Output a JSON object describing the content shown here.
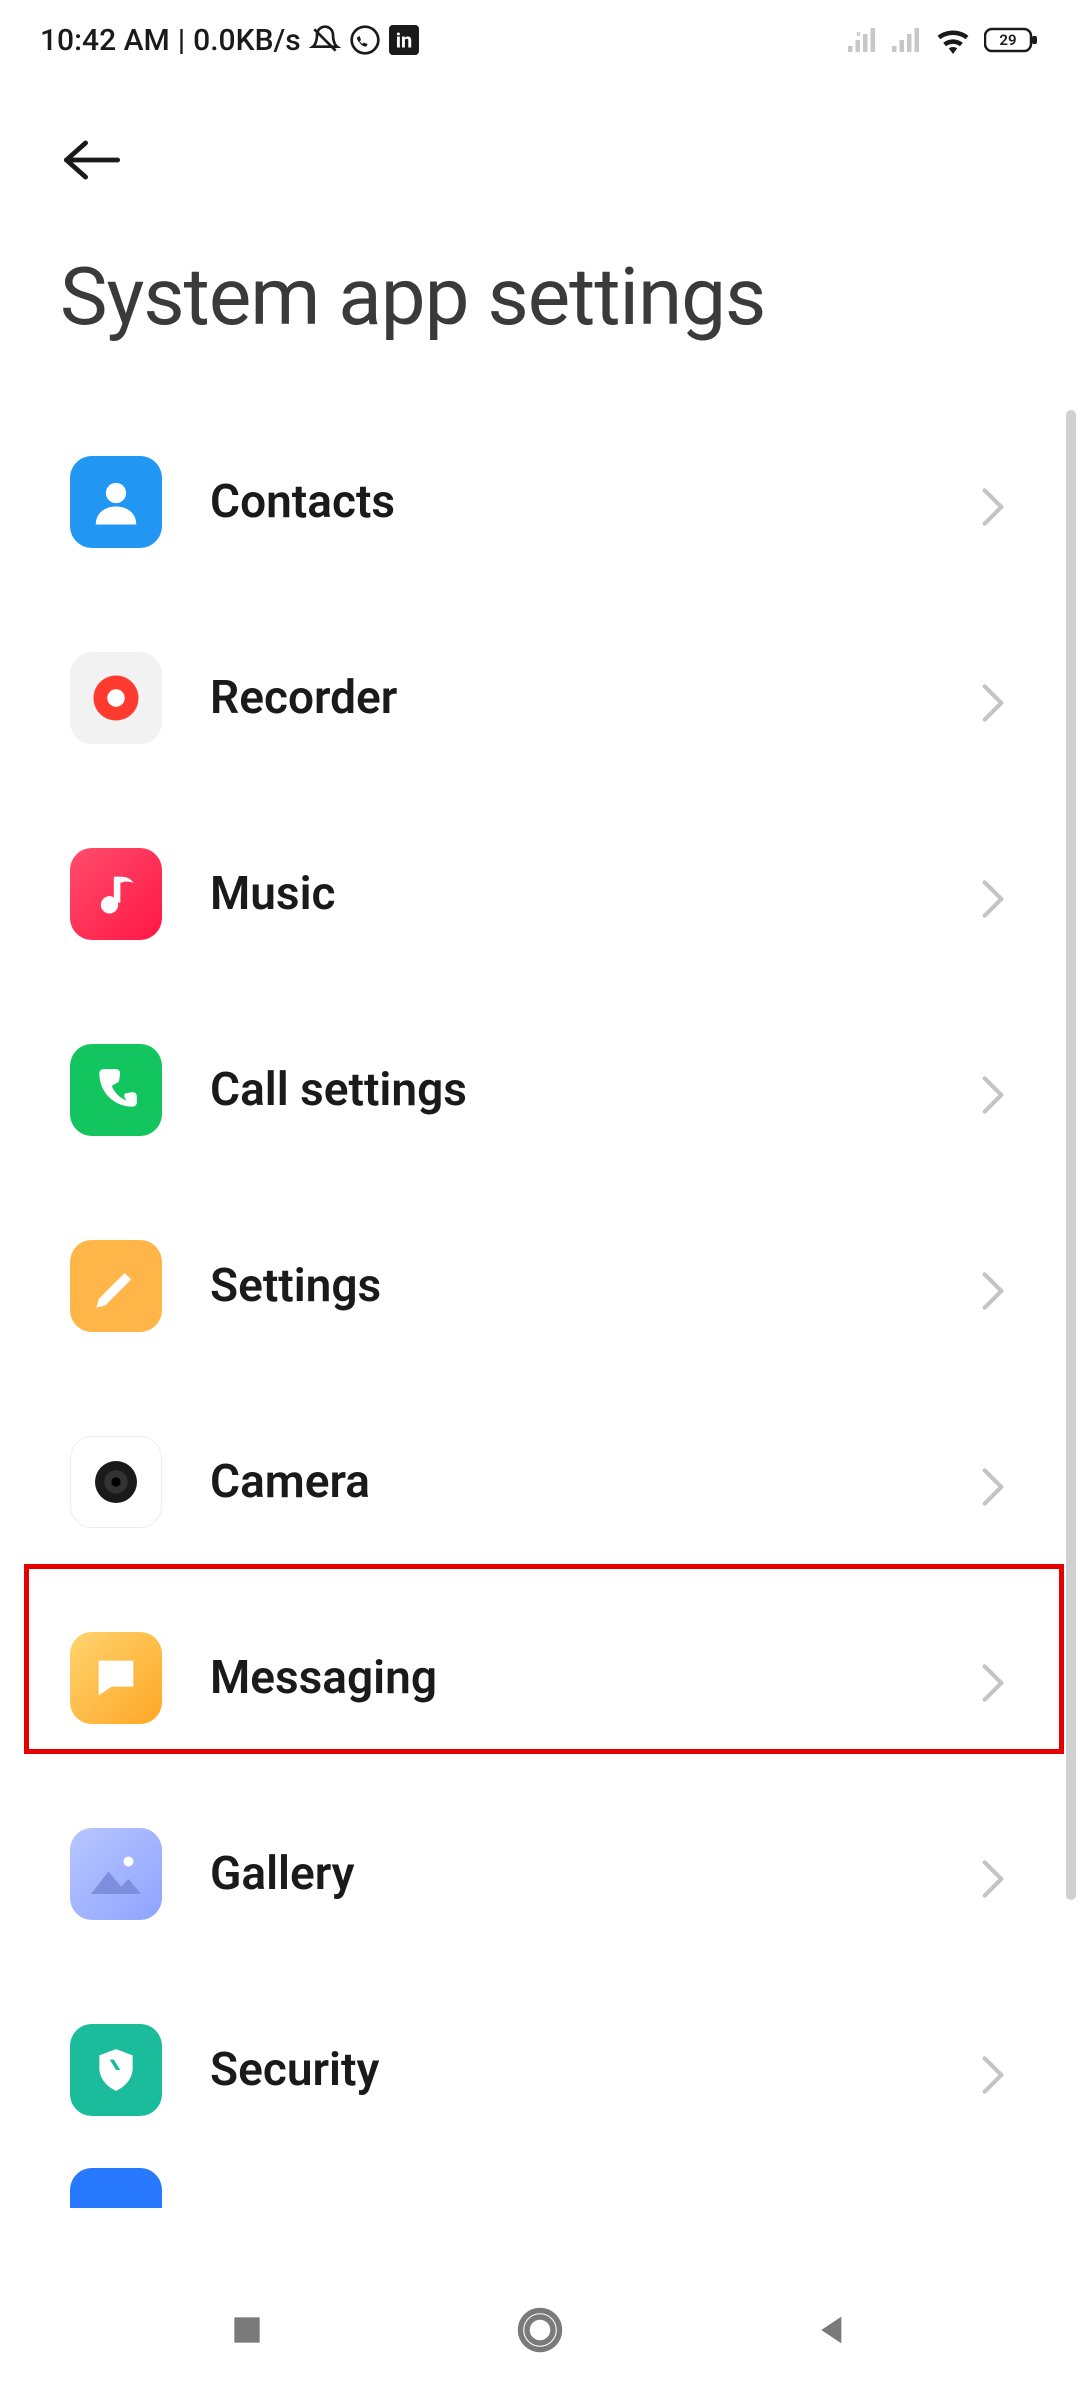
{
  "status_bar": {
    "time": "10:42 AM",
    "separator": "|",
    "network_speed": "0.0KB/s",
    "battery_percent": "29"
  },
  "page": {
    "title": "System app settings"
  },
  "apps": [
    {
      "key": "contacts",
      "label": "Contacts"
    },
    {
      "key": "recorder",
      "label": "Recorder"
    },
    {
      "key": "music",
      "label": "Music"
    },
    {
      "key": "call",
      "label": "Call settings"
    },
    {
      "key": "settings",
      "label": "Settings"
    },
    {
      "key": "camera",
      "label": "Camera"
    },
    {
      "key": "messaging",
      "label": "Messaging"
    },
    {
      "key": "gallery",
      "label": "Gallery"
    },
    {
      "key": "security",
      "label": "Security"
    },
    {
      "key": "calendar",
      "label": ""
    }
  ],
  "highlight": {
    "key": "messaging"
  }
}
